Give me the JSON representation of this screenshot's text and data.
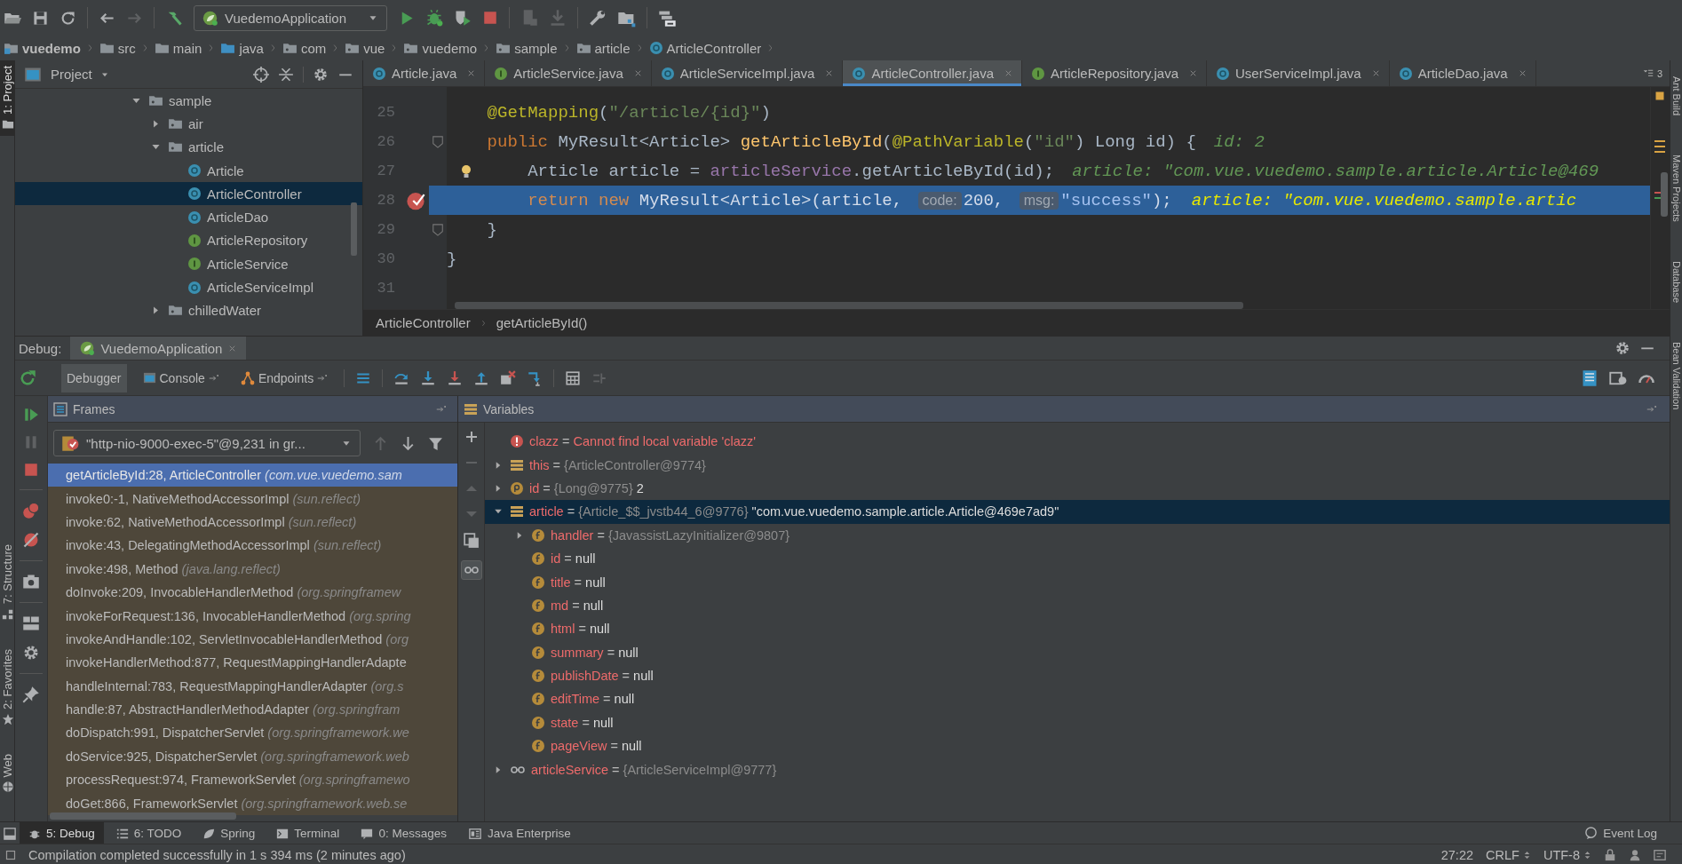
{
  "toolbar": {
    "run_config": "VuedemoApplication"
  },
  "breadcrumb": [
    {
      "label": "vuedemo",
      "kind": "project"
    },
    {
      "label": "src",
      "kind": "folder"
    },
    {
      "label": "main",
      "kind": "folder"
    },
    {
      "label": "java",
      "kind": "source"
    },
    {
      "label": "com",
      "kind": "package"
    },
    {
      "label": "vue",
      "kind": "package"
    },
    {
      "label": "vuedemo",
      "kind": "package"
    },
    {
      "label": "sample",
      "kind": "package"
    },
    {
      "label": "article",
      "kind": "package"
    },
    {
      "label": "ArticleController",
      "kind": "class"
    }
  ],
  "left_strip": [
    {
      "label": "1: Project",
      "selected": true,
      "kind": "project"
    },
    {
      "label": "7: Structure",
      "selected": false,
      "kind": "structure"
    },
    {
      "label": "2: Favorites",
      "selected": false,
      "kind": "favorites"
    },
    {
      "label": "Web",
      "selected": false,
      "kind": "web"
    }
  ],
  "right_strip": [
    "Ant Build",
    "Maven Projects",
    "Database",
    "Bean Validation"
  ],
  "project": {
    "title": "Project",
    "tree": [
      {
        "label": "sample",
        "kind": "package",
        "expanded": true,
        "selected": false,
        "children": [
          {
            "label": "air",
            "kind": "package",
            "expanded": false,
            "selected": false
          },
          {
            "label": "article",
            "kind": "package",
            "expanded": true,
            "selected": false,
            "children": [
              {
                "label": "Article",
                "kind": "class",
                "selected": false
              },
              {
                "label": "ArticleController",
                "kind": "class",
                "selected": true
              },
              {
                "label": "ArticleDao",
                "kind": "class",
                "selected": false
              },
              {
                "label": "ArticleRepository",
                "kind": "interface",
                "selected": false
              },
              {
                "label": "ArticleService",
                "kind": "interface",
                "selected": false
              },
              {
                "label": "ArticleServiceImpl",
                "kind": "class",
                "selected": false
              }
            ]
          },
          {
            "label": "chilledWater",
            "kind": "package",
            "expanded": false,
            "selected": false
          }
        ]
      }
    ]
  },
  "editor": {
    "tabs": [
      {
        "label": "Article.java",
        "kind": "class",
        "selected": false
      },
      {
        "label": "ArticleService.java",
        "kind": "interface",
        "selected": false
      },
      {
        "label": "ArticleServiceImpl.java",
        "kind": "class",
        "selected": false
      },
      {
        "label": "ArticleController.java",
        "kind": "class",
        "selected": true
      },
      {
        "label": "ArticleRepository.java",
        "kind": "interface",
        "selected": false
      },
      {
        "label": "UserServiceImpl.java",
        "kind": "class",
        "selected": false
      },
      {
        "label": "ArticleDao.java",
        "kind": "class",
        "selected": false
      }
    ],
    "tab_overflow": "3",
    "lines": [
      {
        "number": "25",
        "breakpoint": false,
        "current": false,
        "fold": false,
        "intention": false,
        "tokens": [
          {
            "text": "    @GetMapping",
            "kind": "annotation"
          },
          {
            "text": "(",
            "kind": "plain"
          },
          {
            "text": "\"/article/{id}\"",
            "kind": "string"
          },
          {
            "text": ")",
            "kind": "plain"
          }
        ]
      },
      {
        "number": "26",
        "breakpoint": false,
        "current": false,
        "fold": true,
        "intention": false,
        "tokens": [
          {
            "text": "    public",
            "kind": "keyword"
          },
          {
            "text": " MyResult<Article> ",
            "kind": "plain"
          },
          {
            "text": "getArticleById",
            "kind": "method"
          },
          {
            "text": "(",
            "kind": "plain"
          },
          {
            "text": "@PathVariable",
            "kind": "annotation"
          },
          {
            "text": "(",
            "kind": "plain"
          },
          {
            "text": "\"id\"",
            "kind": "string"
          },
          {
            "text": ") Long id) {",
            "kind": "plain"
          },
          {
            "text": "id: 2",
            "kind": "hint"
          }
        ]
      },
      {
        "number": "27",
        "breakpoint": false,
        "current": false,
        "fold": false,
        "intention": true,
        "tokens": [
          {
            "text": "        Article article = ",
            "kind": "plain"
          },
          {
            "text": "articleService",
            "kind": "field"
          },
          {
            "text": ".getArticleById(id);",
            "kind": "plain"
          },
          {
            "text": "article: \"com.vue.vuedemo.sample.article.Article@469",
            "kind": "hint"
          }
        ]
      },
      {
        "number": "28",
        "breakpoint": true,
        "current": true,
        "fold": false,
        "intention": false,
        "tokens": [
          {
            "text": "        return new",
            "kind": "keyword"
          },
          {
            "text": " MyResult<Article>(article, ",
            "kind": "plain"
          },
          {
            "text": "code:",
            "kind": "param"
          },
          {
            "text": "200, ",
            "kind": "number"
          },
          {
            "text": "msg:",
            "kind": "param"
          },
          {
            "text": "\"success\"",
            "kind": "string"
          },
          {
            "text": ");",
            "kind": "plain"
          },
          {
            "text": "article: \"com.vue.vuedemo.sample.artic",
            "kind": "value"
          }
        ]
      },
      {
        "number": "29",
        "breakpoint": false,
        "current": false,
        "fold": true,
        "intention": false,
        "tokens": [
          {
            "text": "    }",
            "kind": "plain"
          }
        ]
      },
      {
        "number": "30",
        "breakpoint": false,
        "current": false,
        "fold": false,
        "intention": false,
        "tokens": [
          {
            "text": "}",
            "kind": "plain"
          }
        ]
      },
      {
        "number": "31",
        "breakpoint": false,
        "current": false,
        "fold": false,
        "intention": false
      }
    ],
    "breadcrumb": [
      "ArticleController",
      "getArticleById()"
    ]
  },
  "debug": {
    "label": "Debug:",
    "session": "VuedemoApplication",
    "tabs": [
      {
        "label": "Debugger",
        "selected": true,
        "kind": "debugger"
      },
      {
        "label": "Console",
        "selected": false,
        "kind": "console"
      },
      {
        "label": "Endpoints",
        "selected": false,
        "kind": "endpoints"
      }
    ],
    "frames": {
      "title": "Frames",
      "thread": "\"http-nio-9000-exec-5\"@9,231 in gr...",
      "items": [
        {
          "method": "getArticleById:28, ArticleController",
          "package": "(com.vue.vuedemo.sam",
          "selected": true,
          "library": false
        },
        {
          "method": "invoke0:-1, NativeMethodAccessorImpl",
          "package": "(sun.reflect)",
          "selected": false,
          "library": true
        },
        {
          "method": "invoke:62, NativeMethodAccessorImpl",
          "package": "(sun.reflect)",
          "selected": false,
          "library": true
        },
        {
          "method": "invoke:43, DelegatingMethodAccessorImpl",
          "package": "(sun.reflect)",
          "selected": false,
          "library": true
        },
        {
          "method": "invoke:498, Method",
          "package": "(java.lang.reflect)",
          "selected": false,
          "library": true
        },
        {
          "method": "doInvoke:209, InvocableHandlerMethod",
          "package": "(org.springframew",
          "selected": false,
          "library": true
        },
        {
          "method": "invokeForRequest:136, InvocableHandlerMethod",
          "package": "(org.spring",
          "selected": false,
          "library": true
        },
        {
          "method": "invokeAndHandle:102, ServletInvocableHandlerMethod",
          "package": "(org",
          "selected": false,
          "library": true
        },
        {
          "method": "invokeHandlerMethod:877, RequestMappingHandlerAdapte",
          "selected": false,
          "library": true
        },
        {
          "method": "handleInternal:783, RequestMappingHandlerAdapter",
          "package": "(org.s",
          "selected": false,
          "library": true
        },
        {
          "method": "handle:87, AbstractHandlerMethodAdapter",
          "package": "(org.springfram",
          "selected": false,
          "library": true
        },
        {
          "method": "doDispatch:991, DispatcherServlet",
          "package": "(org.springframework.we",
          "selected": false,
          "library": true
        },
        {
          "method": "doService:925, DispatcherServlet",
          "package": "(org.springframework.web",
          "selected": false,
          "library": true
        },
        {
          "method": "processRequest:974, FrameworkServlet",
          "package": "(org.springframewo",
          "selected": false,
          "library": true
        },
        {
          "method": "doGet:866, FrameworkServlet",
          "package": "(org.springframework.web.se",
          "selected": false,
          "library": true
        }
      ]
    },
    "variables": {
      "title": "Variables",
      "assign": "=",
      "items": [
        {
          "name": "clazz",
          "kind": "error",
          "message": "Cannot find local variable 'clazz'",
          "selected": false
        },
        {
          "name": "this",
          "kind": "object",
          "expanded": false,
          "ref": "{ArticleController@9774}",
          "selected": false
        },
        {
          "name": "id",
          "kind": "param",
          "expanded": false,
          "ref": "{Long@9775}",
          "value": "2",
          "selected": false
        },
        {
          "name": "article",
          "kind": "object",
          "expanded": true,
          "ref": "{Article_$$_jvstb44_6@9776}",
          "value": "\"com.vue.vuedemo.sample.article.Article@469e7ad9\"",
          "selected": true,
          "children": [
            {
              "name": "handler",
              "kind": "field",
              "expanded": false,
              "ref": "{JavassistLazyInitializer@9807}",
              "selected": false
            },
            {
              "name": "id",
              "kind": "field",
              "value": "null",
              "selected": false
            },
            {
              "name": "title",
              "kind": "field",
              "value": "null",
              "selected": false
            },
            {
              "name": "md",
              "kind": "field",
              "value": "null",
              "selected": false
            },
            {
              "name": "html",
              "kind": "field",
              "value": "null",
              "selected": false
            },
            {
              "name": "summary",
              "kind": "field",
              "value": "null",
              "selected": false
            },
            {
              "name": "publishDate",
              "kind": "field",
              "value": "null",
              "selected": false
            },
            {
              "name": "editTime",
              "kind": "field",
              "value": "null",
              "selected": false
            },
            {
              "name": "state",
              "kind": "field",
              "value": "null",
              "selected": false
            },
            {
              "name": "pageView",
              "kind": "field",
              "value": "null",
              "selected": false
            }
          ]
        },
        {
          "name": "articleService",
          "kind": "watch",
          "expanded": false,
          "ref": "{ArticleServiceImpl@9777}",
          "selected": false
        }
      ]
    }
  },
  "tool_windows": [
    {
      "label": "5: Debug",
      "selected": true,
      "kind": "debug"
    },
    {
      "label": "6: TODO",
      "selected": false,
      "kind": "todo"
    },
    {
      "label": "Spring",
      "selected": false,
      "kind": "spring"
    },
    {
      "label": "Terminal",
      "selected": false,
      "kind": "terminal"
    },
    {
      "label": "0: Messages",
      "selected": false,
      "kind": "messages"
    },
    {
      "label": "Java Enterprise",
      "selected": false,
      "kind": "enterprise"
    }
  ],
  "event_log": "Event Log",
  "status_bar": {
    "message": "Compilation completed successfully in 1 s 394 ms (2 minutes ago)",
    "position": "27:22",
    "line_separator": "CRLF",
    "encoding": "UTF-8"
  }
}
